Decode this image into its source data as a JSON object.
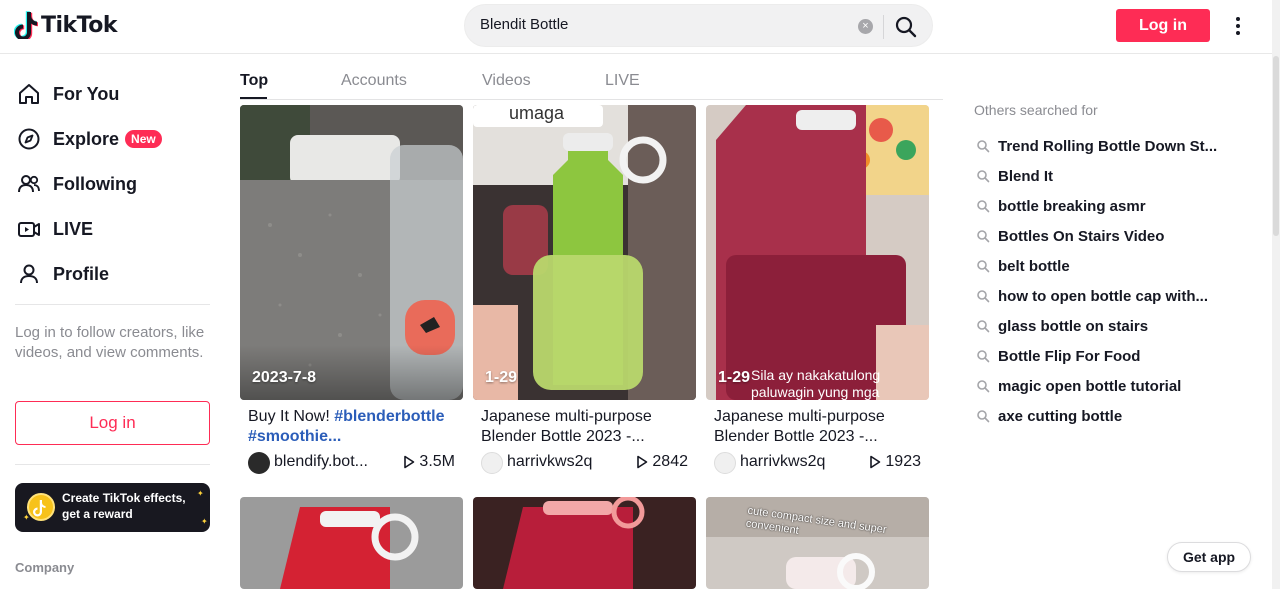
{
  "brand": {
    "name": "TikTok"
  },
  "search": {
    "value": "Blendit Bottle"
  },
  "header": {
    "login_label": "Log in"
  },
  "sidebar": {
    "nav": [
      {
        "label": "For You",
        "icon": "home-icon"
      },
      {
        "label": "Explore",
        "icon": "compass-icon",
        "badge": "New"
      },
      {
        "label": "Following",
        "icon": "users-icon"
      },
      {
        "label": "LIVE",
        "icon": "live-icon"
      },
      {
        "label": "Profile",
        "icon": "person-icon"
      }
    ],
    "note": "Log in to follow creators, like videos, and view comments.",
    "login_label": "Log in",
    "effects_label": "Create TikTok effects, get a reward",
    "company_label": "Company"
  },
  "tabs": [
    "Top",
    "Accounts",
    "Videos",
    "LIVE"
  ],
  "videos": [
    {
      "date": "2023-7-8",
      "desc_text": "Buy It Now! ",
      "desc_tag1": "#blenderbottle",
      "desc_tag2": "#smoothie...",
      "author": "blendify.bot...",
      "views": "3.5M"
    },
    {
      "date": "1-29",
      "overlay": "umaga",
      "desc_text": "Japanese multi-purpose Blender Bottle 2023 -...",
      "author": "harrivkws2q",
      "views": "2842"
    },
    {
      "date": "1-29",
      "overlay": "Sila ay nakakatulong paluwagin yung mga",
      "desc_text": "Japanese multi-purpose Blender Bottle 2023 -...",
      "author": "harrivkws2q",
      "views": "1923"
    },
    {
      "overlay": "cute compact size and super convenient"
    }
  ],
  "others": {
    "title": "Others searched for",
    "items": [
      "Trend Rolling Bottle Down St...",
      "Blend It",
      "bottle breaking asmr",
      "Bottles On Stairs Video",
      "belt bottle",
      "how to open bottle cap with...",
      "glass bottle on stairs",
      "Bottle Flip For Food",
      "magic open bottle tutorial",
      "axe cutting bottle"
    ]
  },
  "getapp_label": "Get app",
  "colors": {
    "brand_red": "#fe2c55",
    "link_blue": "#2b5db9"
  }
}
